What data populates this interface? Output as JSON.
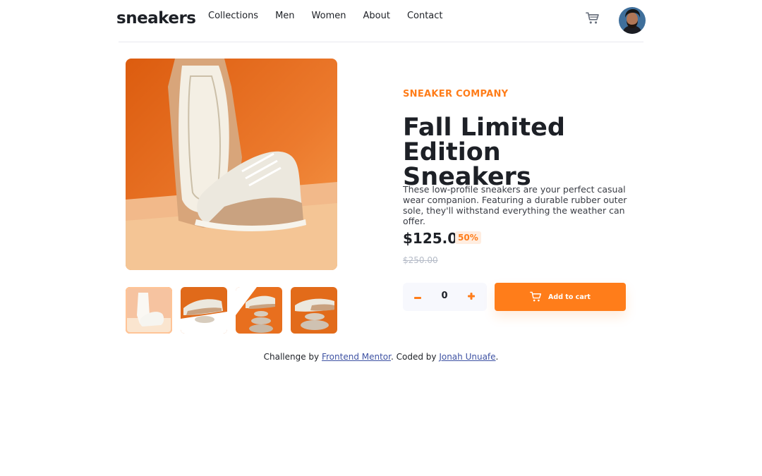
{
  "header": {
    "logo": "sneakers",
    "nav": [
      "Collections",
      "Men",
      "Women",
      "About",
      "Contact"
    ],
    "icons": {
      "cart": "cart-icon",
      "avatar": "user-avatar"
    }
  },
  "gallery": {
    "main_image": "sneaker-sole-and-side-view",
    "thumbnails": [
      {
        "name": "sneaker-pair-thumbnail",
        "active": true
      },
      {
        "name": "sneaker-on-stones-thumbnail",
        "active": false
      },
      {
        "name": "sneaker-balanced-on-stones-thumbnail",
        "active": false
      },
      {
        "name": "sneaker-side-view-thumbnail",
        "active": false
      }
    ]
  },
  "product": {
    "company": "SNEAKER COMPANY",
    "title": "Fall Limited Edition Sneakers",
    "description": "These low-profile sneakers are your perfect casual wear companion. Featuring a durable rubber outer sole, they'll withstand everything the weather can offer.",
    "price": "$125.00",
    "discount": "50%",
    "old_price": "$250.00",
    "quantity": "0",
    "add_to_cart": "Add to cart"
  },
  "attribution": {
    "prefix": "Challenge by",
    "challenge_link": "Frontend Mentor",
    "middle": ". Coded by",
    "author_link": "Jonah Unuafe",
    "suffix": "."
  },
  "colors": {
    "accent": "#ff7d1a",
    "accent_pale": "#ffede0",
    "text": "#1d2026",
    "muted": "#b6bcc8",
    "link": "#3e52a3"
  }
}
